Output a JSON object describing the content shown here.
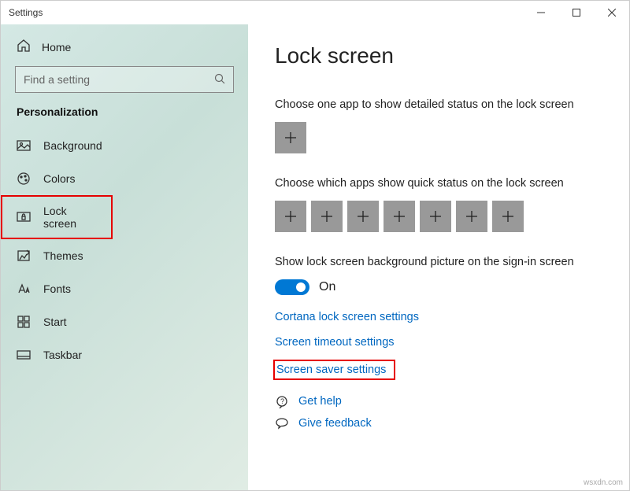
{
  "window_title": "Settings",
  "sidebar": {
    "home": "Home",
    "search_placeholder": "Find a setting",
    "category": "Personalization",
    "items": [
      {
        "label": "Background"
      },
      {
        "label": "Colors"
      },
      {
        "label": "Lock screen"
      },
      {
        "label": "Themes"
      },
      {
        "label": "Fonts"
      },
      {
        "label": "Start"
      },
      {
        "label": "Taskbar"
      }
    ]
  },
  "main": {
    "title": "Lock screen",
    "detailed_label": "Choose one app to show detailed status on the lock screen",
    "quick_label": "Choose which apps show quick status on the lock screen",
    "signin_label": "Show lock screen background picture on the sign-in screen",
    "toggle_state": "On",
    "links": {
      "cortana": "Cortana lock screen settings",
      "timeout": "Screen timeout settings",
      "saver": "Screen saver settings"
    },
    "help": "Get help",
    "feedback": "Give feedback"
  },
  "watermark": "wsxdn.com"
}
